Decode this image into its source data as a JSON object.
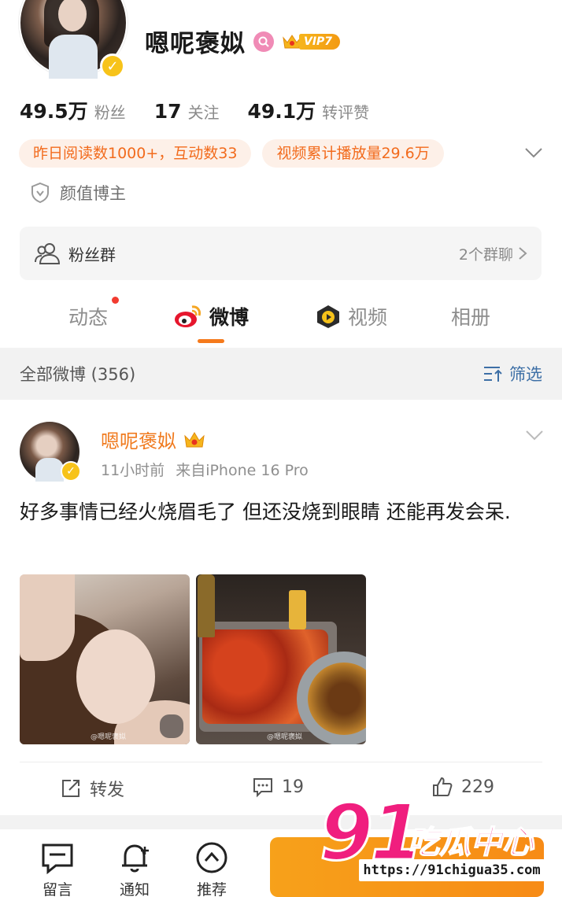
{
  "profile": {
    "username": "嗯呢褒姒",
    "vip_label": "VIP7",
    "stats": [
      {
        "value": "49.5万",
        "label": "粉丝"
      },
      {
        "value": "17",
        "label": "关注"
      },
      {
        "value": "49.1万",
        "label": "转评赞"
      }
    ],
    "pills": [
      "昨日阅读数1000+，互动数33",
      "视频累计播放量29.6万"
    ],
    "tag": "颜值博主",
    "fan_group": {
      "label": "粉丝群",
      "right": "2个群聊"
    }
  },
  "tabs": [
    {
      "label": "动态"
    },
    {
      "label": "微博"
    },
    {
      "label": "视频"
    },
    {
      "label": "相册"
    }
  ],
  "filter": {
    "title": "全部微博 (356)",
    "button": "筛选"
  },
  "post": {
    "author": "嗯呢褒姒",
    "time": "11小时前",
    "source": "来自iPhone 16 Pro",
    "text": "好多事情已经火烧眉毛了 但还没烧到眼睛 还能再发会呆.",
    "image_watermark": "@嗯呢褒姒",
    "actions": {
      "repost": "转发",
      "comments": "19",
      "likes": "229"
    }
  },
  "bottom_nav": [
    {
      "label": "留言"
    },
    {
      "label": "通知"
    },
    {
      "label": "推荐"
    }
  ],
  "overlay_logo": {
    "number": "91",
    "text": "吃瓜中心",
    "url": "https://91chigua35.com"
  },
  "colors": {
    "accent": "#f57a1c",
    "link": "#3d6fa6",
    "vip_gold": "#f6b51c",
    "logo_pink": "#f01e7e"
  }
}
